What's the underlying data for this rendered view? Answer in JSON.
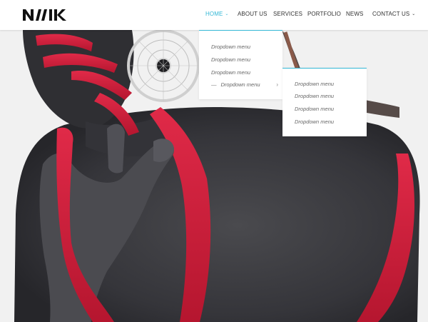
{
  "brand": {
    "logo_text": "NIK"
  },
  "nav": {
    "items": [
      {
        "label": "HOME",
        "active": true,
        "has_caret": true
      },
      {
        "label": "ABOUT US",
        "active": false,
        "has_caret": false
      },
      {
        "label": "SERVICES",
        "active": false,
        "has_caret": false
      },
      {
        "label": "PORTFOLIO",
        "active": false,
        "has_caret": false
      },
      {
        "label": "NEWS",
        "active": false,
        "has_caret": false
      },
      {
        "label": "CONTACT US",
        "active": false,
        "has_caret": true
      }
    ],
    "caret_glyph": "⌄"
  },
  "dropdown_primary": {
    "items": [
      {
        "label": "Dropdown menu"
      },
      {
        "label": "Dropdown menu"
      },
      {
        "label": "Dropdown menu"
      },
      {
        "label": "Dropdown menu",
        "prefix": "—",
        "submenu_arrow": "›"
      }
    ]
  },
  "dropdown_secondary": {
    "items": [
      {
        "label": "Dropdown menu"
      },
      {
        "label": "Dropdown menu"
      },
      {
        "label": "Dropdown menu"
      },
      {
        "label": "Dropdown menu"
      }
    ]
  },
  "colors": {
    "accent": "#35b8d6",
    "header_bg": "#ffffff",
    "hero_bg": "#f1f1f1",
    "skin": "#3a3a3c",
    "paint_red": "#d8203f"
  }
}
